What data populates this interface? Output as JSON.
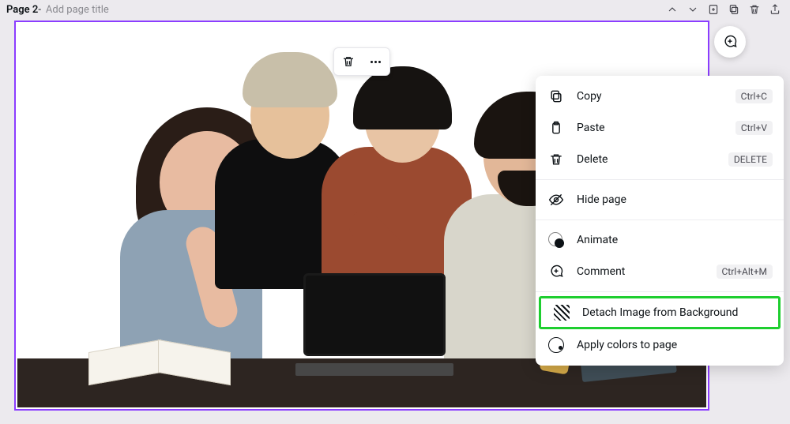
{
  "header": {
    "page_label": "Page 2",
    "separator": " - ",
    "title_placeholder": "Add page title"
  },
  "toolbar_icons": [
    "move-up",
    "move-down",
    "add-page",
    "duplicate-page",
    "delete-page",
    "share-page"
  ],
  "minibar": {
    "actions": [
      "delete",
      "more"
    ]
  },
  "context_menu": {
    "items": [
      {
        "id": "copy",
        "label": "Copy",
        "shortcut": "Ctrl+C"
      },
      {
        "id": "paste",
        "label": "Paste",
        "shortcut": "Ctrl+V"
      },
      {
        "id": "delete",
        "label": "Delete",
        "shortcut": "DELETE"
      },
      {
        "id": "hide",
        "label": "Hide page",
        "shortcut": ""
      },
      {
        "id": "animate",
        "label": "Animate",
        "shortcut": ""
      },
      {
        "id": "comment",
        "label": "Comment",
        "shortcut": "Ctrl+Alt+M"
      },
      {
        "id": "detach",
        "label": "Detach Image from Background",
        "shortcut": "",
        "highlighted": true
      },
      {
        "id": "applyclr",
        "label": "Apply colors to page",
        "shortcut": ""
      }
    ]
  }
}
